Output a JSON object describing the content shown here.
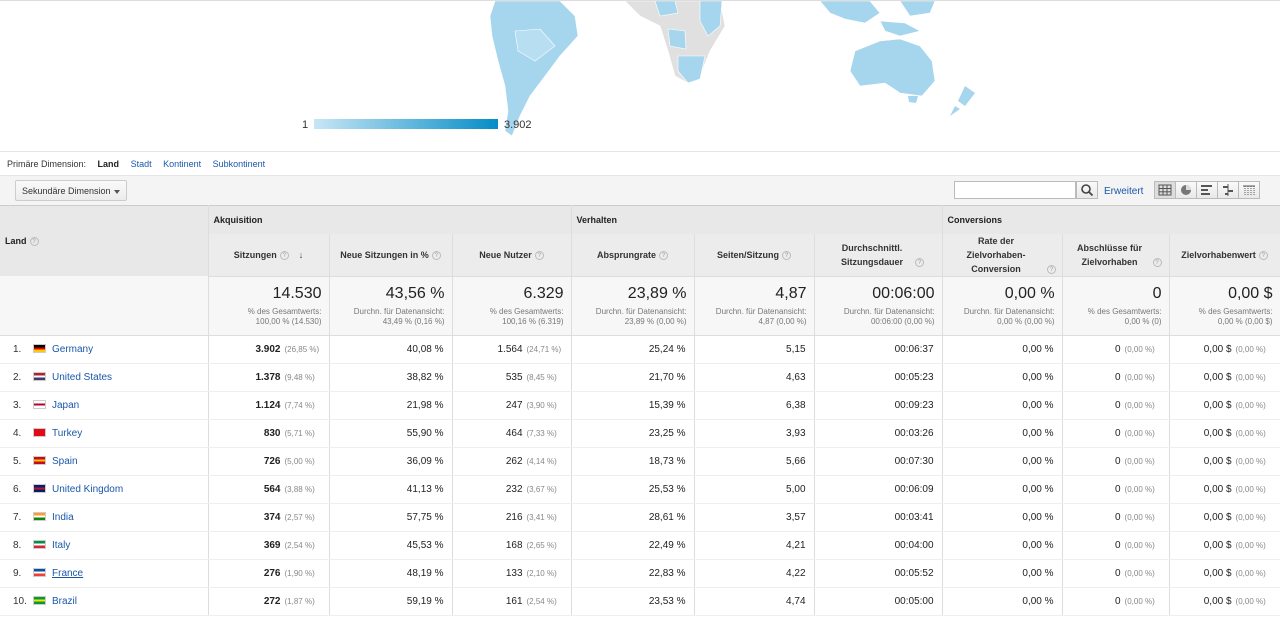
{
  "map": {
    "legend_min": "1",
    "legend_max": "3.902",
    "colors": {
      "low": "#c8e6f5",
      "high": "#058dc7",
      "country": "#a6d5ee",
      "inactive": "#e0e0e0"
    }
  },
  "dimension": {
    "label": "Primäre Dimension:",
    "active": "Land",
    "links": [
      "Stadt",
      "Kontinent",
      "Subkontinent"
    ]
  },
  "toolbar": {
    "secondary_dimension": "Sekundäre Dimension",
    "search_value": "",
    "advanced": "Erweitert"
  },
  "table": {
    "land_header": "Land",
    "groups": {
      "acquisition": "Akquisition",
      "behavior": "Verhalten",
      "conversions": "Conversions"
    },
    "columns": [
      "Sitzungen",
      "Neue Sitzungen in %",
      "Neue Nutzer",
      "Absprungrate",
      "Seiten/Sitzung",
      "Durchschnittl. Sitzungsdauer",
      "Rate der Zielvorhaben-Conversion",
      "Abschlüsse für Zielvorhaben",
      "Zielvorhabenwert"
    ],
    "totals": [
      {
        "big": "14.530",
        "l1": "% des Gesamtwerts:",
        "l2": "100,00 % (14.530)"
      },
      {
        "big": "43,56 %",
        "l1": "Durchn. für Datenansicht:",
        "l2": "43,49 % (0,16 %)"
      },
      {
        "big": "6.329",
        "l1": "% des Gesamtwerts:",
        "l2": "100,16 % (6.319)"
      },
      {
        "big": "23,89 %",
        "l1": "Durchn. für Datenansicht:",
        "l2": "23,89 % (0,00 %)"
      },
      {
        "big": "4,87",
        "l1": "Durchn. für Datenansicht:",
        "l2": "4,87 (0,00 %)"
      },
      {
        "big": "00:06:00",
        "l1": "Durchn. für Datenansicht:",
        "l2": "00:06:00 (0,00 %)"
      },
      {
        "big": "0,00 %",
        "l1": "Durchn. für Datenansicht:",
        "l2": "0,00 % (0,00 %)"
      },
      {
        "big": "0",
        "l1": "% des Gesamtwerts:",
        "l2": "0,00 % (0)"
      },
      {
        "big": "0,00 $",
        "l1": "% des Gesamtwerts:",
        "l2": "0,00 % (0,00 $)"
      }
    ],
    "rows": [
      {
        "n": "1.",
        "country": "Germany",
        "sessions": "3.902",
        "sessions_pct": "(26,85 %)",
        "new_sessions": "40,08 %",
        "new_users": "1.564",
        "new_users_pct": "(24,71 %)",
        "bounce": "25,24 %",
        "pages": "5,15",
        "duration": "00:06:37",
        "conv_rate": "0,00 %",
        "goals": "0",
        "goals_pct": "(0,00 %)",
        "value": "0,00 $",
        "value_pct": "(0,00 %)"
      },
      {
        "n": "2.",
        "country": "United States",
        "sessions": "1.378",
        "sessions_pct": "(9,48 %)",
        "new_sessions": "38,82 %",
        "new_users": "535",
        "new_users_pct": "(8,45 %)",
        "bounce": "21,70 %",
        "pages": "4,63",
        "duration": "00:05:23",
        "conv_rate": "0,00 %",
        "goals": "0",
        "goals_pct": "(0,00 %)",
        "value": "0,00 $",
        "value_pct": "(0,00 %)"
      },
      {
        "n": "3.",
        "country": "Japan",
        "sessions": "1.124",
        "sessions_pct": "(7,74 %)",
        "new_sessions": "21,98 %",
        "new_users": "247",
        "new_users_pct": "(3,90 %)",
        "bounce": "15,39 %",
        "pages": "6,38",
        "duration": "00:09:23",
        "conv_rate": "0,00 %",
        "goals": "0",
        "goals_pct": "(0,00 %)",
        "value": "0,00 $",
        "value_pct": "(0,00 %)"
      },
      {
        "n": "4.",
        "country": "Turkey",
        "sessions": "830",
        "sessions_pct": "(5,71 %)",
        "new_sessions": "55,90 %",
        "new_users": "464",
        "new_users_pct": "(7,33 %)",
        "bounce": "23,25 %",
        "pages": "3,93",
        "duration": "00:03:26",
        "conv_rate": "0,00 %",
        "goals": "0",
        "goals_pct": "(0,00 %)",
        "value": "0,00 $",
        "value_pct": "(0,00 %)"
      },
      {
        "n": "5.",
        "country": "Spain",
        "sessions": "726",
        "sessions_pct": "(5,00 %)",
        "new_sessions": "36,09 %",
        "new_users": "262",
        "new_users_pct": "(4,14 %)",
        "bounce": "18,73 %",
        "pages": "5,66",
        "duration": "00:07:30",
        "conv_rate": "0,00 %",
        "goals": "0",
        "goals_pct": "(0,00 %)",
        "value": "0,00 $",
        "value_pct": "(0,00 %)"
      },
      {
        "n": "6.",
        "country": "United Kingdom",
        "sessions": "564",
        "sessions_pct": "(3,88 %)",
        "new_sessions": "41,13 %",
        "new_users": "232",
        "new_users_pct": "(3,67 %)",
        "bounce": "25,53 %",
        "pages": "5,00",
        "duration": "00:06:09",
        "conv_rate": "0,00 %",
        "goals": "0",
        "goals_pct": "(0,00 %)",
        "value": "0,00 $",
        "value_pct": "(0,00 %)"
      },
      {
        "n": "7.",
        "country": "India",
        "sessions": "374",
        "sessions_pct": "(2,57 %)",
        "new_sessions": "57,75 %",
        "new_users": "216",
        "new_users_pct": "(3,41 %)",
        "bounce": "28,61 %",
        "pages": "3,57",
        "duration": "00:03:41",
        "conv_rate": "0,00 %",
        "goals": "0",
        "goals_pct": "(0,00 %)",
        "value": "0,00 $",
        "value_pct": "(0,00 %)"
      },
      {
        "n": "8.",
        "country": "Italy",
        "sessions": "369",
        "sessions_pct": "(2,54 %)",
        "new_sessions": "45,53 %",
        "new_users": "168",
        "new_users_pct": "(2,65 %)",
        "bounce": "22,49 %",
        "pages": "4,21",
        "duration": "00:04:00",
        "conv_rate": "0,00 %",
        "goals": "0",
        "goals_pct": "(0,00 %)",
        "value": "0,00 $",
        "value_pct": "(0,00 %)"
      },
      {
        "n": "9.",
        "country": "France",
        "sessions": "276",
        "sessions_pct": "(1,90 %)",
        "new_sessions": "48,19 %",
        "new_users": "133",
        "new_users_pct": "(2,10 %)",
        "bounce": "22,83 %",
        "pages": "4,22",
        "duration": "00:05:52",
        "conv_rate": "0,00 %",
        "goals": "0",
        "goals_pct": "(0,00 %)",
        "value": "0,00 $",
        "value_pct": "(0,00 %)"
      },
      {
        "n": "10.",
        "country": "Brazil",
        "sessions": "272",
        "sessions_pct": "(1,87 %)",
        "new_sessions": "59,19 %",
        "new_users": "161",
        "new_users_pct": "(2,54 %)",
        "bounce": "23,53 %",
        "pages": "4,74",
        "duration": "00:05:00",
        "conv_rate": "0,00 %",
        "goals": "0",
        "goals_pct": "(0,00 %)",
        "value": "0,00 $",
        "value_pct": "(0,00 %)"
      }
    ],
    "flags": [
      [
        "#000",
        "#d00",
        "#fc0"
      ],
      [
        "#b22234",
        "#fff",
        "#3c3b6e"
      ],
      [
        "#fff",
        "#bc002d",
        "#fff"
      ],
      [
        "#e30a17",
        "#e30a17",
        "#e30a17"
      ],
      [
        "#c60b1e",
        "#ffc400",
        "#c60b1e"
      ],
      [
        "#012169",
        "#c8102e",
        "#012169"
      ],
      [
        "#f93",
        "#fff",
        "#138808"
      ],
      [
        "#009246",
        "#fff",
        "#ce2b37"
      ],
      [
        "#0055a4",
        "#fff",
        "#ef4135"
      ],
      [
        "#009c3b",
        "#ffdf00",
        "#009c3b"
      ]
    ]
  }
}
